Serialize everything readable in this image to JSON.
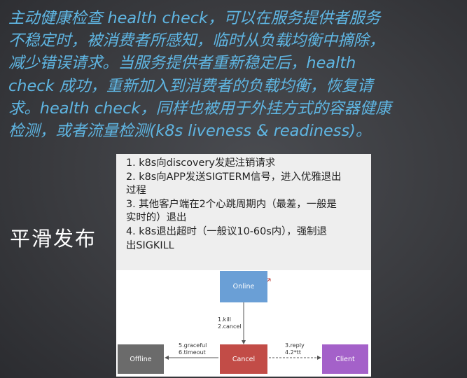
{
  "intro": {
    "lines": [
      "主动健康检查 health check，可以在服务提供者服务",
      "不稳定时，被消费者所感知，临时从负载均衡中摘除，",
      "减少错误请求。当服务提供者重新稳定后，health",
      "check 成功，重新加入到消费者的负载均衡，恢复请",
      "求。health check，同样也被用于外挂方式的容器健康",
      "检测，或者流量检测(k8s liveness & readiness)。"
    ]
  },
  "side_title": "平滑发布",
  "steps": [
    "1. k8s向discovery发起注销请求",
    "2. k8s向APP发送SIGTERM信号，进入优雅退出",
    "过程",
    "3. 其他客户端在2个心跳周期内（最差，一般是",
    "实时的）退出",
    "4. k8s退出超时（一般议10-60s内），强制退",
    "出SIGKILL"
  ],
  "diagram": {
    "nodes": {
      "online": "Online",
      "cancel": "Cancel",
      "offline": "Offline",
      "client": "Client"
    },
    "edges": {
      "kill_line1": "1.kill",
      "kill_line2": "2.cancel",
      "graceful_line1": "5.graceful",
      "graceful_line2": "6.timeout",
      "reply_line1": "3.reply",
      "reply_line2": "4.2*tt"
    },
    "colors": {
      "online": "#6a9fd6",
      "cancel": "#c24c47",
      "offline": "#6b6b6b",
      "client": "#a461c9"
    }
  }
}
